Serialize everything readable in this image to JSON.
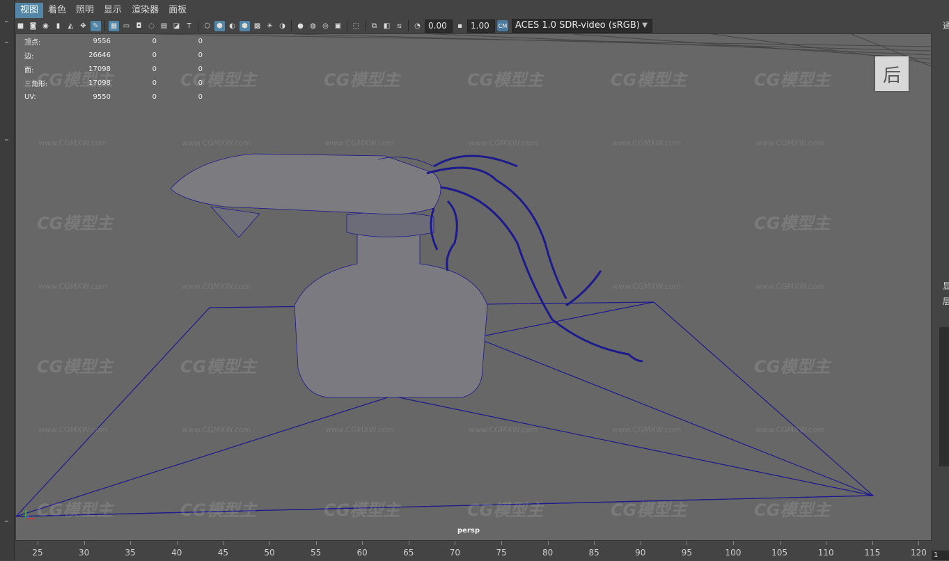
{
  "menu": [
    "视图",
    "着色",
    "照明",
    "显示",
    "渲染器",
    "面板"
  ],
  "toolbar": {
    "exposure_value": "0.00",
    "gamma_value": "1.00",
    "color_space": "ACES 1.0 SDR-video (sRGB)",
    "icons": [
      "camera-icon",
      "camera-attr-icon",
      "bookmark-icon",
      "image-plane-icon",
      "pan-zoom-icon",
      "grease-pencil-icon",
      "grid-icon",
      "film-gate-icon",
      "resolution-gate-icon",
      "gate-mask-icon",
      "field-chart-icon",
      "safe-action-icon",
      "safe-title-icon",
      "wireframe-icon",
      "smooth-shade-icon",
      "default-material-icon",
      "wireframe-on-shaded-icon",
      "textured-icon",
      "lights-icon",
      "shadows-icon",
      "ambient-occlusion-icon",
      "motion-blur-icon",
      "anti-alias-icon",
      "isolate-select-icon",
      "xray-icon",
      "xray-joints-icon",
      "backface-icon",
      "exposure-icon",
      "gamma-icon",
      "color-mgmt-icon"
    ]
  },
  "hud": {
    "rows": [
      {
        "label": "顶点:",
        "v1": "9556",
        "v2": "0",
        "v3": "0"
      },
      {
        "label": "边:",
        "v1": "26646",
        "v2": "0",
        "v3": "0"
      },
      {
        "label": "面:",
        "v1": "17098",
        "v2": "0",
        "v3": "0"
      },
      {
        "label": "三角形:",
        "v1": "17098",
        "v2": "0",
        "v3": "0"
      },
      {
        "label": "UV:",
        "v1": "9550",
        "v2": "0",
        "v3": "0"
      }
    ]
  },
  "viewport": {
    "camera_label": "persp",
    "viewcube_label": "后",
    "wire_color": "#1d1a8c",
    "watermark": "CG模型主",
    "watermark_url": "www.CGMXW.com"
  },
  "right_panel": {
    "top_char": "通",
    "mid_char_1": "显",
    "mid_char_2": "层"
  },
  "timeline": {
    "ticks": [
      "25",
      "30",
      "35",
      "40",
      "45",
      "50",
      "55",
      "60",
      "65",
      "70",
      "75",
      "80",
      "85",
      "90",
      "95",
      "100",
      "105",
      "110",
      "115",
      "120"
    ],
    "current_frame": "1"
  }
}
